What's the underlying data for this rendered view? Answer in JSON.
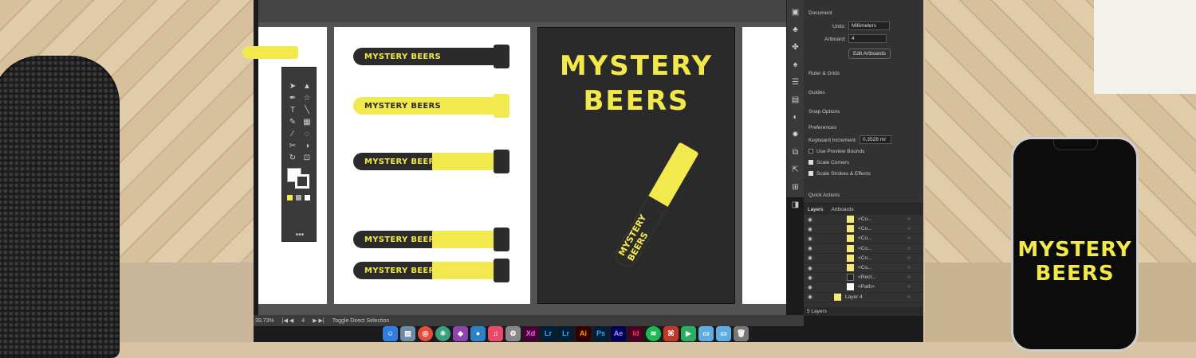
{
  "brand": {
    "logo_line1": "MYSTERY",
    "logo_line2": "BEERS",
    "band_text": "MYSTERY BEERS",
    "accent": "#f2e94e",
    "dark": "#2b2b2b"
  },
  "artboard_labels": {
    "band1": "MYSTERY BEERS",
    "band2": "MYSTERY BEERS",
    "band3": "MYSTERY BEERS",
    "band4": "MYSTERY BEERS",
    "band5": "MYSTERY BEERS",
    "diag": "MYSTERY BEERS"
  },
  "properties": {
    "document_heading": "Document",
    "units_label": "Units:",
    "units_value": "Millimeters",
    "artboard_label": "Artboard:",
    "artboard_value": "4",
    "edit_artboards_button": "Edit Artboards",
    "ruler_grids": "Ruler & Grids",
    "guides": "Guides",
    "snap_options": "Snap Options",
    "preferences": "Preferences",
    "keyboard_increment_label": "Keyboard Increment:",
    "keyboard_increment_value": "0,3528 mr",
    "use_preview_bounds": "Use Preview Bounds",
    "scale_corners": "Scale Corners",
    "scale_strokes_effects": "Scale Strokes & Effects",
    "quick_actions": "Quick Actions"
  },
  "layers": {
    "tab_layers": "Layers",
    "tab_artboards": "Artboards",
    "rows": [
      "<Co...",
      "<Co...",
      "<Co...",
      "<Co...",
      "<Co...",
      "<Co...",
      "<Rect...",
      "<Path>",
      "Layer 4"
    ],
    "footer": "5 Layers"
  },
  "status": {
    "zoom": "39,73%",
    "artboard": "4",
    "tool": "Toggle Direct Selection"
  },
  "dock": [
    "Xd",
    "Lr",
    "Lr",
    "Ai",
    "Ps",
    "Ae",
    "Id"
  ],
  "phone": {
    "logo_line1": "MYSTERY",
    "logo_line2": "BEERS"
  }
}
